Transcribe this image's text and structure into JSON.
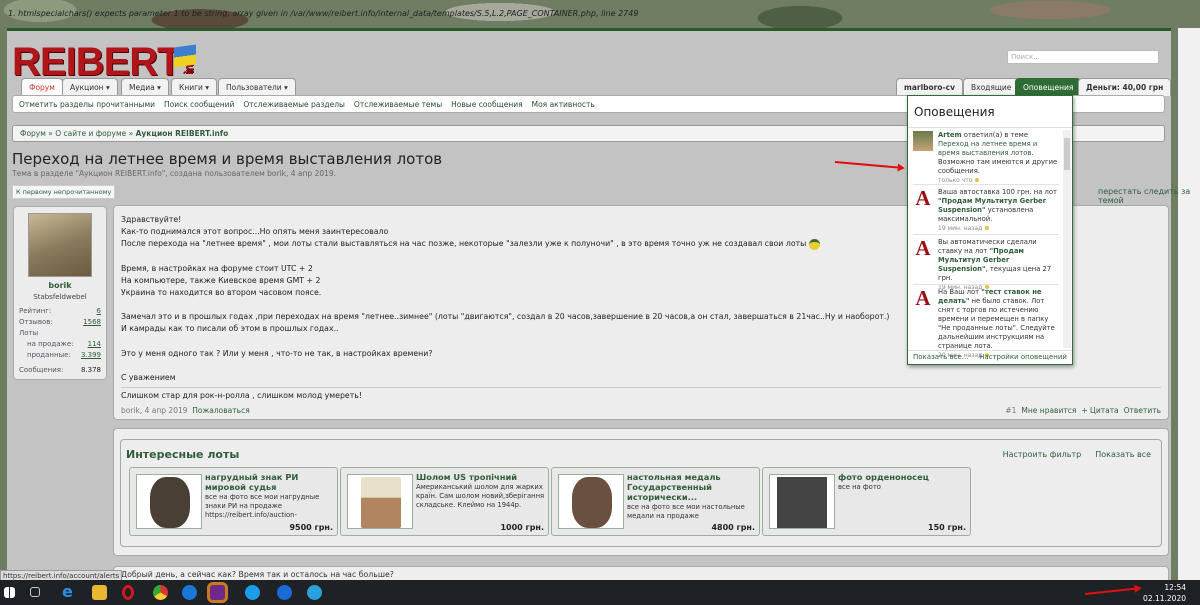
{
  "error_text": "1. htmlspecialchars() expects parameter 1 to be string, array given in /var/www/reibert.info/internal_data/templates/S.5,L.2,PAGE_CONTAINER.php, line 2749",
  "logo": {
    "text": "REIBERT",
    "suffix": "info"
  },
  "search_placeholder": "Поиск...",
  "tabs": [
    "Форум",
    "Аукцион",
    "Медиа",
    "Книги",
    "Пользователи"
  ],
  "account_tabs": {
    "user": "marlboro-cv",
    "inbox": "Входящие",
    "alerts": "Оповещения",
    "money": "Деньги: 40,00 грн"
  },
  "subnav": [
    "Отметить разделы прочитанными",
    "Поиск сообщений",
    "Отслеживаемые разделы",
    "Отслеживаемые темы",
    "Новые сообщения",
    "Моя активность"
  ],
  "breadcrumb": [
    "Форум",
    "О сайте и форуме",
    "Аукцион REIBERT.info"
  ],
  "thread": {
    "title": "Переход на летнее время и время выставления лотов",
    "subtitle": "Тема в разделе \"Аукцион REIBERT.info\", создана пользователем borik, 4 апр 2019.",
    "first_unread": "К первому непрочитанному",
    "stop_watch": "перестать следить за темой"
  },
  "user": {
    "name": "borik",
    "title": "Stabsfeldwebel",
    "stats": [
      {
        "label": "Рейтинг:",
        "value": "6"
      },
      {
        "label": "Отзывов:",
        "value": "1568"
      },
      {
        "label": "Лоты",
        "value": ""
      },
      {
        "label": "на продаже:",
        "value": "114"
      },
      {
        "label": "проданные:",
        "value": "3.399"
      },
      {
        "label": "Сообщения:",
        "value": "8.378"
      }
    ]
  },
  "post": {
    "lines": [
      "Здравствуйте!",
      "Как-то поднимался этот вопрос...Но опять меня заинтересовало",
      "После перехода на \"летнее время\" , мои лоты стали выставляться на час позже, некоторые \"залезли уже к полуночи\" , в это время точно уж не создавал свои лоты",
      "",
      "Время, в настройках на форуме стоит UTC + 2",
      "На компьютере, также Киевское время GMT + 2",
      "Украина то находится во втором часовом поясе.",
      "",
      "Замечал это и в прошлых годах ,при переходах на время \"летнее..зимнее\" (лоты \"двигаются\", создал в 20 часов,завершение в 20 часов,а он стал, завершаться в 21час..Ну и наоборот.)",
      "И камрады как то писали об этом в прошлых годах..",
      "",
      "Это у меня одного так ? Или у меня , что-то не так, в настройках времени?",
      "",
      "С уважением"
    ],
    "signature": "Слишком стар для рок-н-ролла , слишком молод умереть!",
    "author_date": "borik, 4 апр 2019",
    "report": "Пожаловаться",
    "number": "#1",
    "like": "Мне нравится",
    "quote": "+ Цитата",
    "reply": "Ответить"
  },
  "lots": {
    "title": "Интересные лоты",
    "filter": "Настроить фильтр",
    "show_all": "Показать все",
    "items": [
      {
        "title": "нагрудный знак РИ мировой судья",
        "desc": "все на фото все мои нагрудные знаки РИ на продаже https://reibert.info/auction-",
        "price": "9500 грн."
      },
      {
        "title": "Шолом US тропічний",
        "desc": "Американський шолом для жарких країн. Сам шолом новий,зберігання складське. Клеймо на 1944р.",
        "price": "1000 грн."
      },
      {
        "title": "настольная медаль Государственный исторически...",
        "desc": "все на фото все мои настольные медали на продаже",
        "price": "4800 грн."
      },
      {
        "title": "фото орденоносец",
        "desc": "все на фото",
        "price": "150 грн."
      }
    ]
  },
  "next_post": "Добрый день, а сейчас как? Время так и осталось на час больше?",
  "status_url": "https://reibert.info/account/alerts",
  "alerts": {
    "title": "Оповещения",
    "show_all": "Показать все...",
    "settings": "Настройки оповещений",
    "items": [
      {
        "icon": "avatar",
        "pre": "",
        "user": "Artem",
        "text1": " ответил(а) в теме ",
        "link": "Переход на летнее время и время выставления лотов",
        "text2": ". Возможно там имеются и другие сообщения.",
        "time": "только что"
      },
      {
        "icon": "auction-a",
        "pre": "Ваша автоставка 100 грн. на лот ",
        "link": "\"Продам Мультитул Gerber Suspension\"",
        "text2": " установлена максимальной.",
        "time": "19 мин. назад"
      },
      {
        "icon": "auction-a",
        "pre": "Вы автоматически сделали ставку на лот ",
        "link": "\"Продам Мультитул Gerber Suspension\"",
        "text2": ", текущая цена 27 грн.",
        "time": "19 мин. назад"
      },
      {
        "icon": "auction-a",
        "pre": "На Ваш лот ",
        "link": "\"тест ставок не делать\"",
        "text2": " не было ставок. Лот снят с торгов по истечению времени и перемещен в папку \"Не проданные лоты\". Следуйте дальнейшим инструкциям на странице лота.",
        "time": "20 мин. назад"
      }
    ]
  },
  "clock": {
    "time": "12:54",
    "date": "02.11.2020"
  },
  "colors": {
    "brand_green": "#2f6c35",
    "logo_red": "#b0151b",
    "arrow_red": "#e01010"
  }
}
